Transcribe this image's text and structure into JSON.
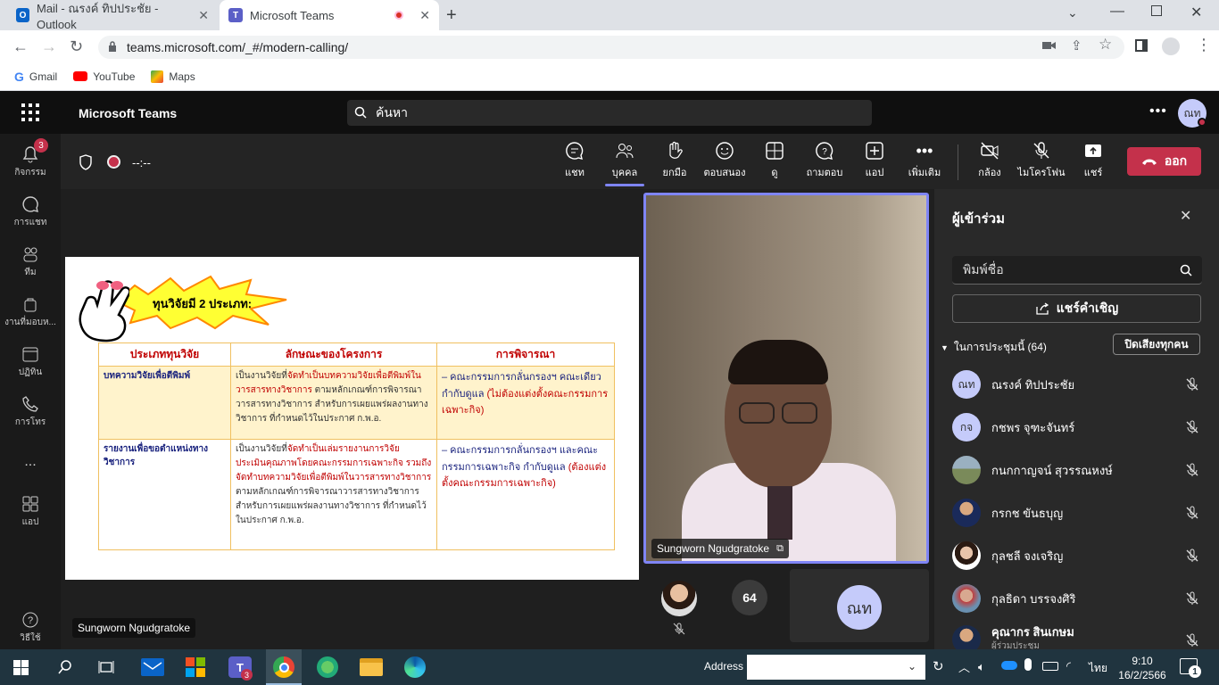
{
  "browser": {
    "tabs": [
      {
        "title": "Mail - ณรงค์ ทิปประชัย - Outlook",
        "favicon": "outlook-icon"
      },
      {
        "title": "Microsoft Teams",
        "favicon": "teams-icon"
      }
    ],
    "url": "teams.microsoft.com/_#/modern-calling/",
    "bookmarks": [
      "Gmail",
      "YouTube",
      "Maps"
    ]
  },
  "teams": {
    "app_title": "Microsoft Teams",
    "search_placeholder": "ค้นหา",
    "profile_initials": "ณท",
    "rail": [
      {
        "label": "กิจกรรม",
        "icon": "bell-icon",
        "badge": "3"
      },
      {
        "label": "การแชท",
        "icon": "chat-icon"
      },
      {
        "label": "ทีม",
        "icon": "teams-icon"
      },
      {
        "label": "งานที่มอบห...",
        "icon": "assignments-icon"
      },
      {
        "label": "ปฏิทิน",
        "icon": "calendar-icon"
      },
      {
        "label": "การโทร",
        "icon": "phone-icon"
      },
      {
        "label": "...",
        "icon": "more-icon"
      },
      {
        "label": "แอป",
        "icon": "apps-icon"
      }
    ],
    "help_label": "วิธีใช้",
    "meeting": {
      "timer": "--:--",
      "toolbar": [
        "แชท",
        "บุคคล",
        "ยกมือ",
        "ตอบสนอง",
        "ดู",
        "ถามตอบ",
        "แอป",
        "เพิ่มเติม",
        "กล้อง",
        "ไมโครโฟน",
        "แชร์"
      ],
      "leave_label": "ออก"
    },
    "stage": {
      "presenter_label": "Sungworn Ngudgratoke",
      "video_name": "Sungworn Ngudgratoke",
      "more_count": "64",
      "self_initials": "ณท"
    },
    "slide": {
      "banner": "ทุนวิจัยมี 2 ประเภท:",
      "headers": [
        "ประเภททุนวิจัย",
        "ลักษณะของโครงการ",
        "การพิจารณา"
      ],
      "rows": [
        {
          "type": "บทความวิจัยเพื่อตีพิมพ์",
          "desc_a": "เป็นงานวิจัยที่",
          "desc_b": "จัดทำเป็นบทความวิจัยเพื่อตีพิมพ์ในวารสารทางวิชาการ",
          "desc_c": " ตามหลักเกณฑ์การพิจารณาวารสารทางวิชาการ สำหรับการเผยแพร่ผลงานทางวิชาการ ที่กำหนดไว้ในประกาศ ก.พ.อ.",
          "cons_a": "– คณะกรรมการกลั่นกรองฯ คณะเดียว กำกับดูแล ",
          "cons_b": "(ไม่ต้องแต่งตั้งคณะกรรมการเฉพาะกิจ)"
        },
        {
          "type": "รายงานเพื่อขอตำแหน่งทางวิชาการ",
          "desc_a": "เป็นงานวิจัยที่",
          "desc_b": "จัดทำเป็นเล่มรายงานการวิจัย ประเมินคุณภาพโดยคณะกรรมการเฉพาะกิจ รวมถึงจัดทำบทความวิจัยเพื่อตีพิมพ์ในวารสารทางวิชาการ",
          "desc_c": " ตามหลักเกณฑ์การพิจารณาวารสารทางวิชาการ สำหรับการเผยแพร่ผลงานทางวิชาการ ที่กำหนดไว้ในประกาศ ก.พ.อ.",
          "cons_a": "– คณะกรรมการกลั่นกรองฯ และคณะกรรมการเฉพาะกิจ กำกับดูแล ",
          "cons_b": "(ต้องแต่งตั้งคณะกรรมการเฉพาะกิจ)"
        }
      ]
    },
    "participants_panel": {
      "title": "ผู้เข้าร่วม",
      "search_placeholder": "พิมพ์ชื่อ",
      "share_invite": "แชร์คำเชิญ",
      "section_label": "ในการประชุมนี้ (64)",
      "mute_all": "ปิดเสียงทุกคน",
      "people": [
        {
          "name": "ณรงค์ ทิปประชัย",
          "initials": "ณท",
          "color": "#c5cbfa"
        },
        {
          "name": "กชพร จุฑะจันทร์",
          "initials": "กจ",
          "color": "#c5cbfa"
        },
        {
          "name": "กนกกาญจน์ สุวรรณหงษ์",
          "initials": "",
          "color": "#8a9a6a"
        },
        {
          "name": "กรกช ขันธบุญ",
          "initials": "",
          "color": "#3a4a7a"
        },
        {
          "name": "กุลชลี จงเจริญ",
          "initials": "",
          "color": "#d9b8a8"
        },
        {
          "name": "กุลธิดา บรรจงศิริ",
          "initials": "",
          "color": "#a07060"
        },
        {
          "name": "คุณากร สินเกษม",
          "initials": "",
          "color": "#2a3a5a",
          "sub": "ผู้ร่วมประชุม"
        }
      ]
    }
  },
  "taskbar": {
    "address_label": "Address",
    "language": "ไทย",
    "time": "9:10",
    "date": "16/2/2566",
    "teams_badge": "3",
    "notif_count": "1"
  }
}
